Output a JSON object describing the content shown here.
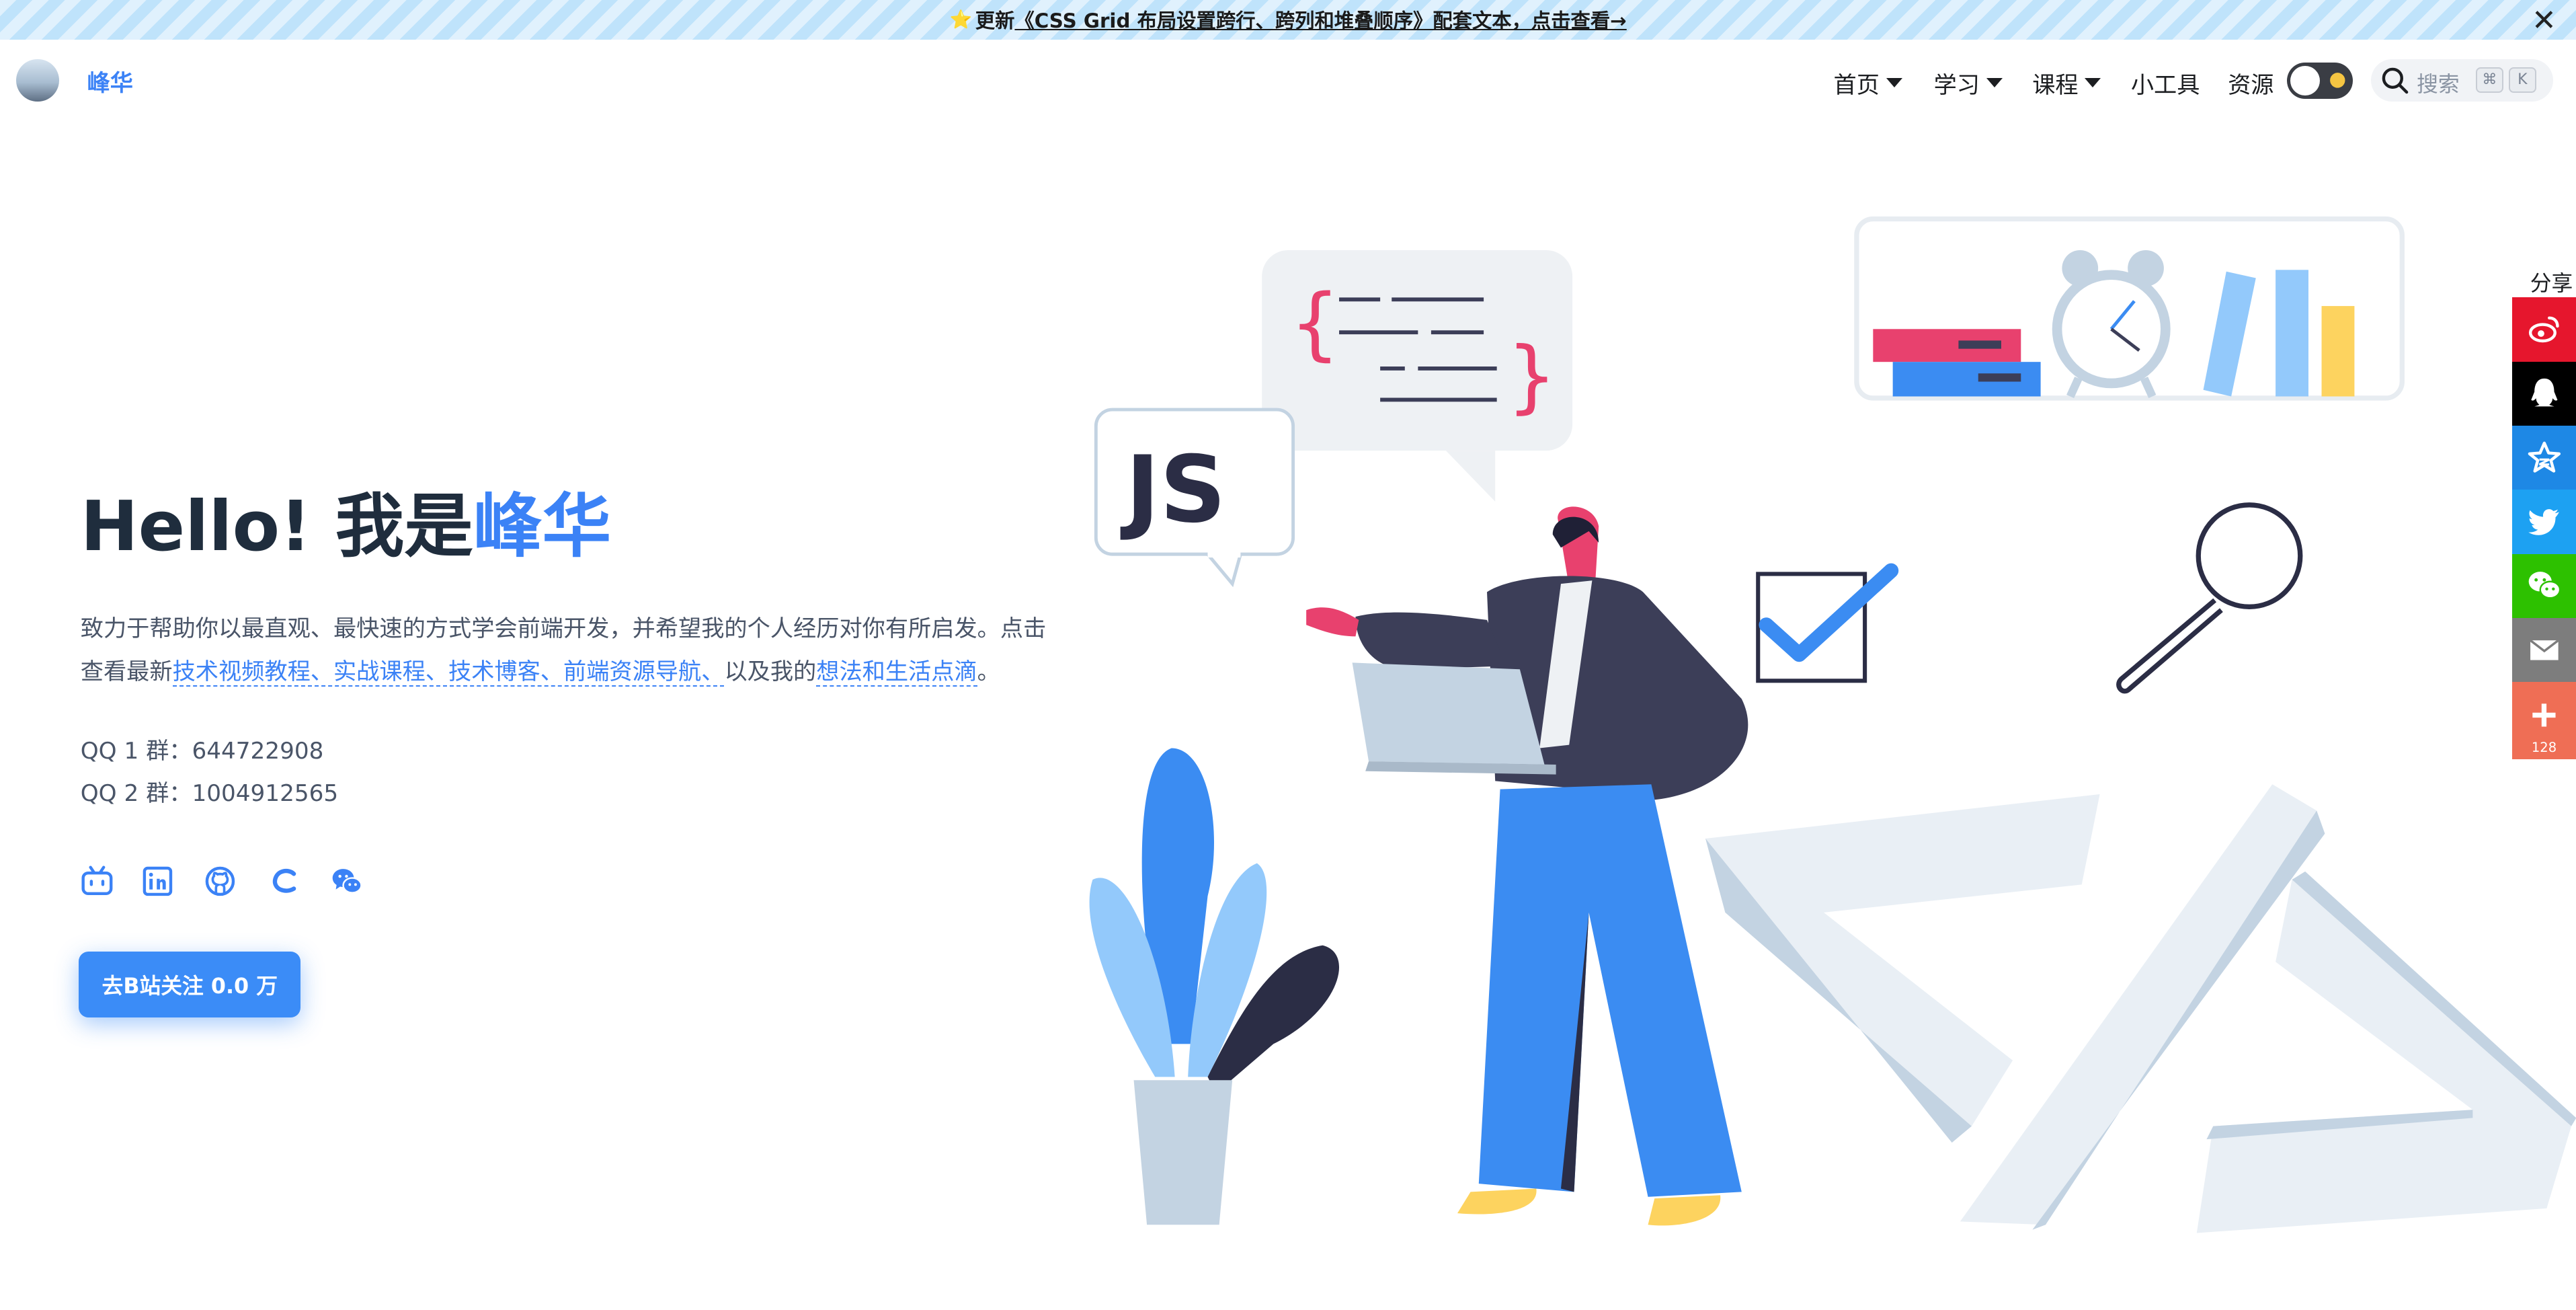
{
  "announcement": {
    "prefix": "更新",
    "link_text": "《CSS Grid 布局设置跨行、跨列和堆叠顺序》配套文本，点击查看→",
    "close": "✕"
  },
  "brand": {
    "name": "峰华"
  },
  "nav": {
    "items": [
      {
        "label": "首页",
        "has_dropdown": true
      },
      {
        "label": "学习",
        "has_dropdown": true
      },
      {
        "label": "课程",
        "has_dropdown": true
      },
      {
        "label": "小工具",
        "has_dropdown": false
      },
      {
        "label": "资源",
        "has_dropdown": false
      }
    ],
    "search": {
      "placeholder": "搜索",
      "key1": "⌘",
      "key2": "K"
    },
    "theme_toggle_icon": "sun-icon"
  },
  "hero": {
    "hello": "Hello! 我是",
    "name": "峰华",
    "desc1": "致力于帮助你以最直观、最快速的方式学会前端开发，并希望我的个人经历对你有所启发。点击查看最新",
    "link1": "技术视频教程、实战课程、技术博客、前端资源导航、",
    "desc2": "以及我的",
    "link2": "想法和生活点滴",
    "desc3": "。",
    "qq1": "QQ 1 群：644722908",
    "qq2": "QQ 2 群：1004912565",
    "cta": "去B站关注 0.0 万",
    "social_icons": [
      "bilibili-icon",
      "linkedin-icon",
      "github-icon",
      "csdn-icon",
      "wechat-icon"
    ]
  },
  "share": {
    "title": "分享",
    "count": "128",
    "buttons": [
      {
        "name": "weibo-icon",
        "color": "#e6162d"
      },
      {
        "name": "qq-icon",
        "color": "#000000"
      },
      {
        "name": "qzone-icon",
        "color": "#1e88e5"
      },
      {
        "name": "twitter-icon",
        "color": "#1da1f2"
      },
      {
        "name": "wechat-icon",
        "color": "#2dc100"
      },
      {
        "name": "email-icon",
        "color": "#7d7d7d"
      },
      {
        "name": "more-icon",
        "color": "#ef6e55"
      }
    ]
  },
  "illustration": {
    "js_text": "JS"
  },
  "colors": {
    "accent": "#3b82f6"
  }
}
